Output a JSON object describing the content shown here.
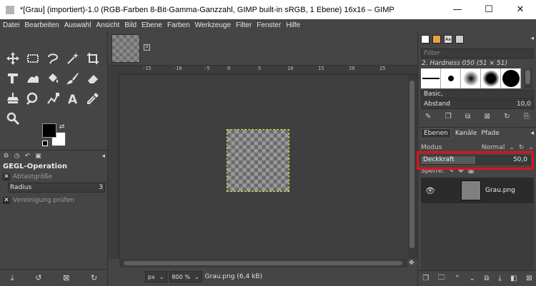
{
  "window": {
    "title": "*[Grau] (importiert)-1.0 (RGB-Farben 8-Bit-Gamma-Ganzzahl, GIMP built-in sRGB, 1 Ebene) 16x16 – GIMP",
    "minimize": "—",
    "maximize": "☐",
    "close": "✕"
  },
  "menu": [
    "Datei",
    "Bearbeiten",
    "Auswahl",
    "Ansicht",
    "Bild",
    "Ebene",
    "Farben",
    "Werkzeuge",
    "Filter",
    "Fenster",
    "Hilfe"
  ],
  "colors": {
    "foreground": "#000000",
    "background": "#ffffff",
    "highlight": "#e01020"
  },
  "toolbox": {
    "tools": [
      "move-tool-icon",
      "rect-select-icon",
      "free-select-icon",
      "fuzzy-select-icon",
      "crop-icon",
      "transform-icon",
      "warp-icon",
      "bucket-fill-icon",
      "paintbrush-icon",
      "eraser-icon",
      "clone-icon",
      "smudge-icon",
      "path-icon",
      "text-icon",
      "color-picker-icon",
      "zoom-icon"
    ],
    "tool_options": {
      "title": "GEGL-Operation",
      "sample_size_label": "Abtastgröße",
      "radius_label": "Radius",
      "radius_value": "3",
      "merge_check_label": "Vereinigung prüfen"
    }
  },
  "ruler": {
    "ticks": [
      "-15",
      "-10",
      "-5",
      "0",
      "5",
      "10",
      "15",
      "20",
      "25"
    ]
  },
  "status": {
    "unit": "px",
    "zoom": "800 %",
    "info": "Grau.png (6,4 kB)"
  },
  "brushes": {
    "filter_placeholder": "Filter",
    "selected_name": "2. Hardness 050 (51 × 51)",
    "preset": "Basic,",
    "spacing_label": "Abstand",
    "spacing_value": "10,0"
  },
  "layers": {
    "tabs": [
      "Ebenen",
      "Kanäle",
      "Pfade"
    ],
    "mode_label": "Modus",
    "mode_value": "Normal",
    "opacity_label": "Deckkraft",
    "opacity_value": "50,0",
    "opacity_fraction": 0.5,
    "lock_label": "Sperre:",
    "items": [
      {
        "name": "Grau.png"
      }
    ]
  }
}
